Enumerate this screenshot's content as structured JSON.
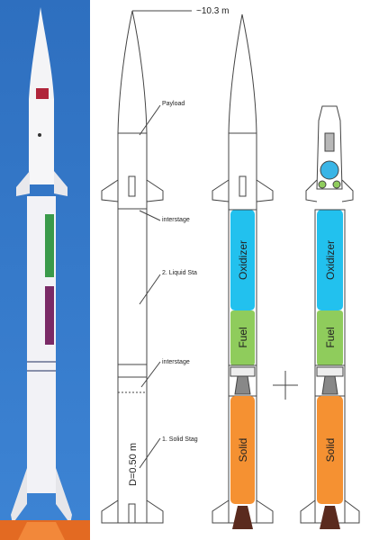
{
  "photo": {
    "sky_top": "#2e6fbf",
    "sky_bottom": "#3f86d6",
    "flame": "#e8641e"
  },
  "outline": {
    "length_label": "~10.3 m",
    "diameter_label": "D=0.50 m",
    "callouts": {
      "payload": "Payload",
      "interstage_top": "interstage",
      "liquid_stage": "2. Liquid Sta",
      "interstage_bottom": "interstage",
      "solid_stage": "1. Solid Stag"
    }
  },
  "stages": {
    "oxidizer": "Oxidizer",
    "fuel": "Fuel",
    "solid": "Solid"
  },
  "colors": {
    "oxidizer": "#22c1ee",
    "fuel": "#8fcc5c",
    "solid": "#f59132",
    "nozzle": "#5a2a1e",
    "payload_tank": "#3ab5e6",
    "payload_green": "#8fcc5c",
    "payload_box": "#b8b8b8",
    "valve": "#7ab7e2",
    "line": "#444444"
  }
}
